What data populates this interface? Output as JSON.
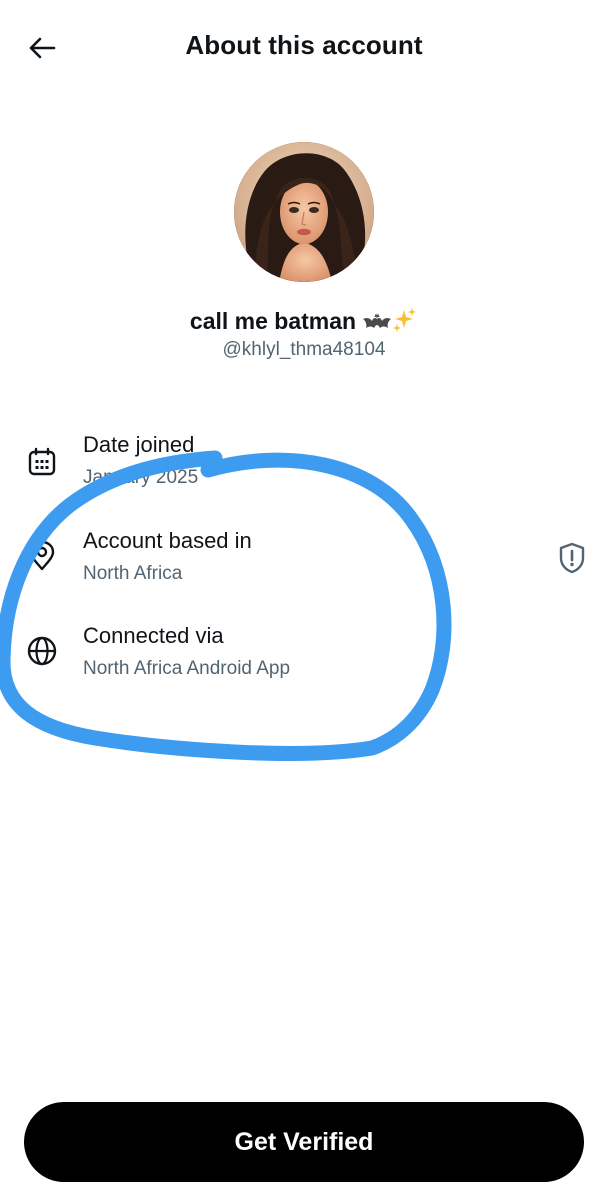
{
  "header": {
    "title": "About this account",
    "back_icon": "arrow-left-icon"
  },
  "profile": {
    "display_name": "call me batman",
    "name_emojis": [
      "bat-icon",
      "sparkles-icon"
    ],
    "handle": "@khlyl_thma48104"
  },
  "info": [
    {
      "icon": "calendar-icon",
      "label": "Date joined",
      "value": "January 2025"
    },
    {
      "icon": "location-pin-icon",
      "label": "Account based in",
      "value": "North Africa"
    },
    {
      "icon": "globe-icon",
      "label": "Connected via",
      "value": "North Africa Android App"
    }
  ],
  "side_action": {
    "icon": "shield-alert-icon"
  },
  "footer": {
    "button_label": "Get Verified"
  },
  "colors": {
    "text_primary": "#0f1419",
    "text_secondary": "#536471",
    "button_bg": "#000000",
    "button_text": "#ffffff",
    "annotation_stroke": "#3d9bf0"
  }
}
